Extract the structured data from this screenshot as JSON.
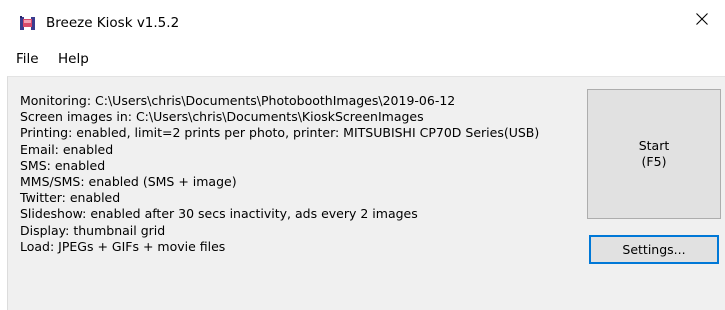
{
  "window": {
    "title": "Breeze Kiosk v1.5.2"
  },
  "menu": {
    "file": "File",
    "help": "Help"
  },
  "status_lines": [
    "Monitoring: C:\\Users\\chris\\Documents\\PhotoboothImages\\2019-06-12",
    "Screen images in: C:\\Users\\chris\\Documents\\KioskScreenImages",
    "Printing: enabled, limit=2 prints per photo, printer: MITSUBISHI CP70D Series(USB)",
    "Email: enabled",
    "SMS: enabled",
    "MMS/SMS: enabled (SMS + image)",
    "Twitter: enabled",
    "Slideshow: enabled after 30 secs inactivity, ads every 2 images",
    "Display: thumbnail grid",
    "Load: JPEGs + GIFs + movie files"
  ],
  "buttons": {
    "start_line1": "Start",
    "start_line2": "(F5)",
    "settings": "Settings..."
  },
  "icons": {
    "app": "breeze-app-icon",
    "close": "close-icon"
  },
  "colors": {
    "client_background": "#f0f0f0",
    "button_face": "#e1e1e1",
    "focus_border": "#0078d7"
  }
}
